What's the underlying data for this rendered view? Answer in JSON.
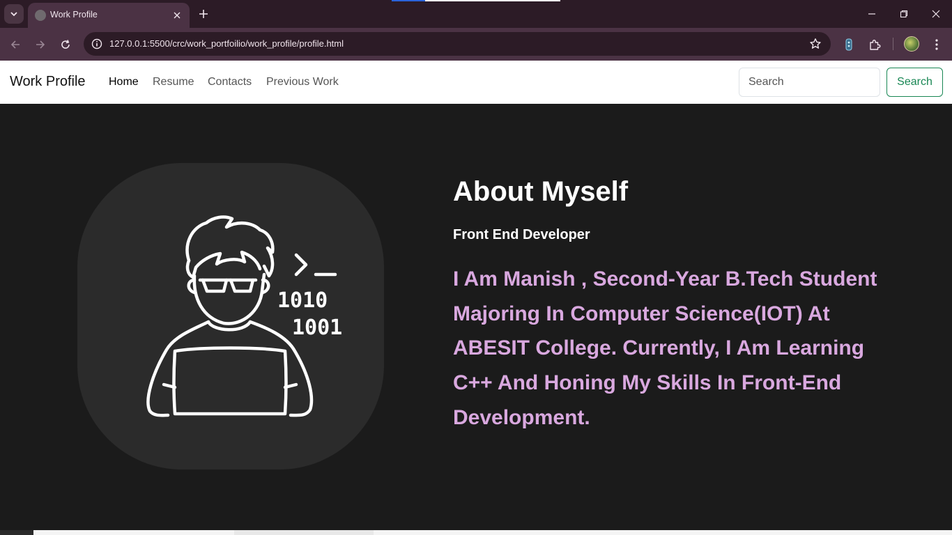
{
  "browser": {
    "tab_title": "Work Profile",
    "url": "127.0.0.1:5500/crc/work_portfoilio/work_profile/profile.html",
    "icons": [
      "tab-list-icon",
      "globe-icon",
      "close-icon",
      "plus-icon",
      "minimize-icon",
      "restore-icon",
      "window-close-icon",
      "back-arrow-icon",
      "forward-arrow-icon",
      "reload-icon",
      "site-info-icon",
      "star-icon",
      "extension-icon",
      "puzzle-icon",
      "avatar",
      "kebab-menu-icon"
    ]
  },
  "navbar": {
    "brand": "Work Profile",
    "links": [
      "Home",
      "Resume",
      "Contacts",
      "Previous Work"
    ],
    "active_link": "Home",
    "search_placeholder": "Search",
    "search_button": "Search",
    "accent_color": "#198754"
  },
  "hero": {
    "title": "About Myself",
    "role": "Front End Developer",
    "bio": "I Am Manish , Second-Year B.Tech Student Majoring In Computer Science(IOT) At ABESIT College. Currently, I Am Learning C++ And Honing My Skills In Front-End Development.",
    "bio_color": "#d9a8df",
    "illustration": {
      "prompt_text": ">_",
      "binary_line_1": "1010",
      "binary_line_2": "1001"
    }
  }
}
